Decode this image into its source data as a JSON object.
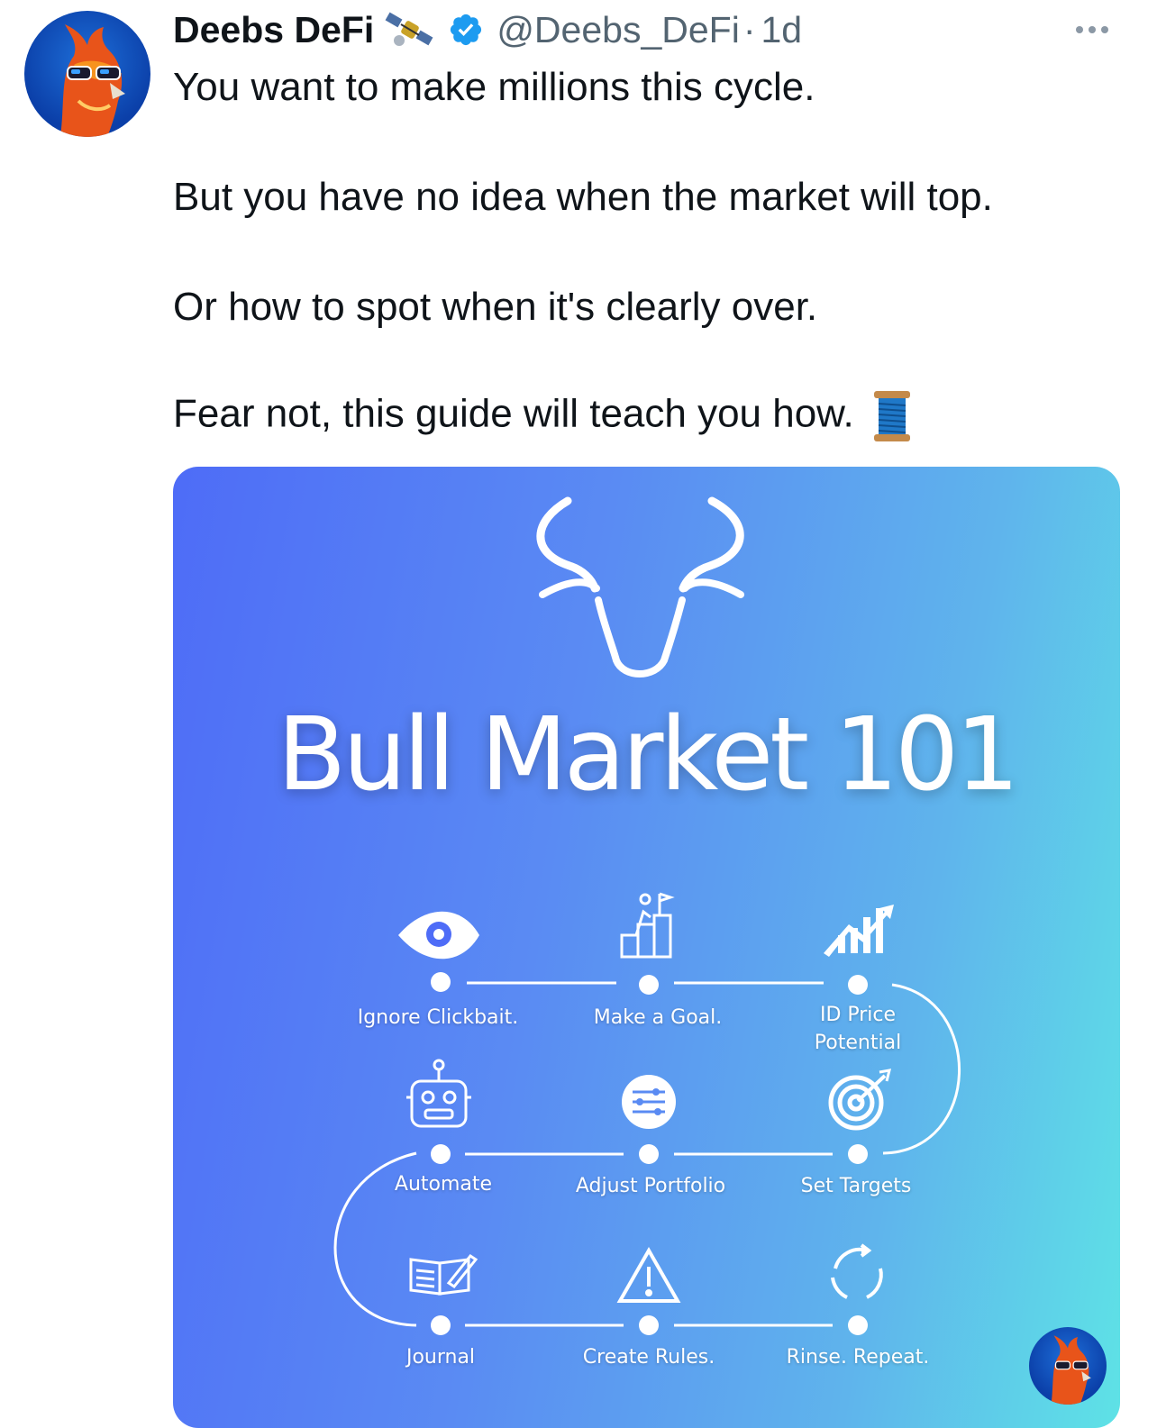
{
  "tweet": {
    "author_name": "Deebs DeFi",
    "author_emoji": "satellite-emoji",
    "verified": true,
    "handle": "@Deebs_DeFi",
    "separator": "·",
    "time": "1d",
    "lines": [
      "You want to make millions this cycle.",
      "But you have no idea when the market will top.",
      "Or how to spot when it's clearly over.",
      "Fear not, this guide will teach you how."
    ],
    "trailing_emoji": "thread-spool-emoji"
  },
  "media": {
    "title": "Bull Market 101",
    "steps": [
      {
        "label": "Ignore Clickbait.",
        "icon": "eye-icon"
      },
      {
        "label": "Make a Goal.",
        "icon": "goal-flag-icon"
      },
      {
        "label": "ID Price Potential",
        "icon": "growth-chart-icon"
      },
      {
        "label": "Automate",
        "icon": "robot-icon"
      },
      {
        "label": "Adjust Portfolio",
        "icon": "sliders-icon"
      },
      {
        "label": "Set Targets",
        "icon": "target-icon"
      },
      {
        "label": "Journal",
        "icon": "book-icon"
      },
      {
        "label": "Create Rules.",
        "icon": "warning-icon"
      },
      {
        "label": "Rinse. Repeat.",
        "icon": "cycle-icon"
      }
    ]
  },
  "colors": {
    "verified_blue": "#1d9bf0",
    "handle_gray": "#536471",
    "gradient_start": "#4e6cf7",
    "gradient_end": "#5ee2e6"
  }
}
